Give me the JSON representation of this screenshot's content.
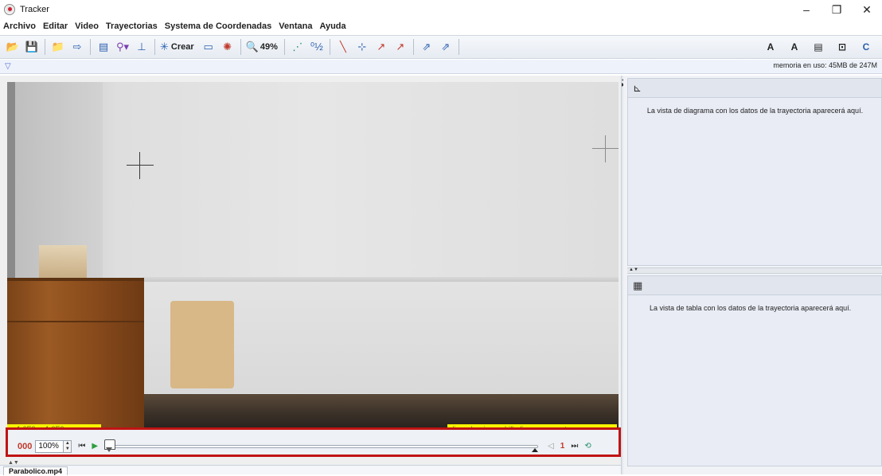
{
  "window": {
    "title": "Tracker",
    "minimize": "–",
    "maximize": "❐",
    "close": "✕"
  },
  "menu": [
    "Archivo",
    "Editar",
    "Video",
    "Trayectorias",
    "Systema de Coordenadas",
    "Ventana",
    "Ayuda"
  ],
  "toolbar": {
    "crear_label": "Crear",
    "zoom_label": "49%",
    "fontsize_down": "A",
    "fontsize_up": "A"
  },
  "infobar": {
    "memory": "memoria en uso: 45MB de 247M"
  },
  "video": {
    "coord_readout": "x -1.6E0  y -1.0E0",
    "hint": "clic: selecciona; shift-clic: marca punto"
  },
  "player": {
    "frame": "000",
    "speed": "100%",
    "step": "1"
  },
  "tabs": {
    "file": "Parabolico.mp4"
  },
  "panels": {
    "plot_message": "La vista de diagrama con los datos de la trayectoria aparecerá aquí.",
    "table_message": "La vista de tabla con los datos de la trayectoria aparecerá aquí."
  },
  "colors": {
    "highlight": "#c01414",
    "readout": "#f7f300"
  }
}
